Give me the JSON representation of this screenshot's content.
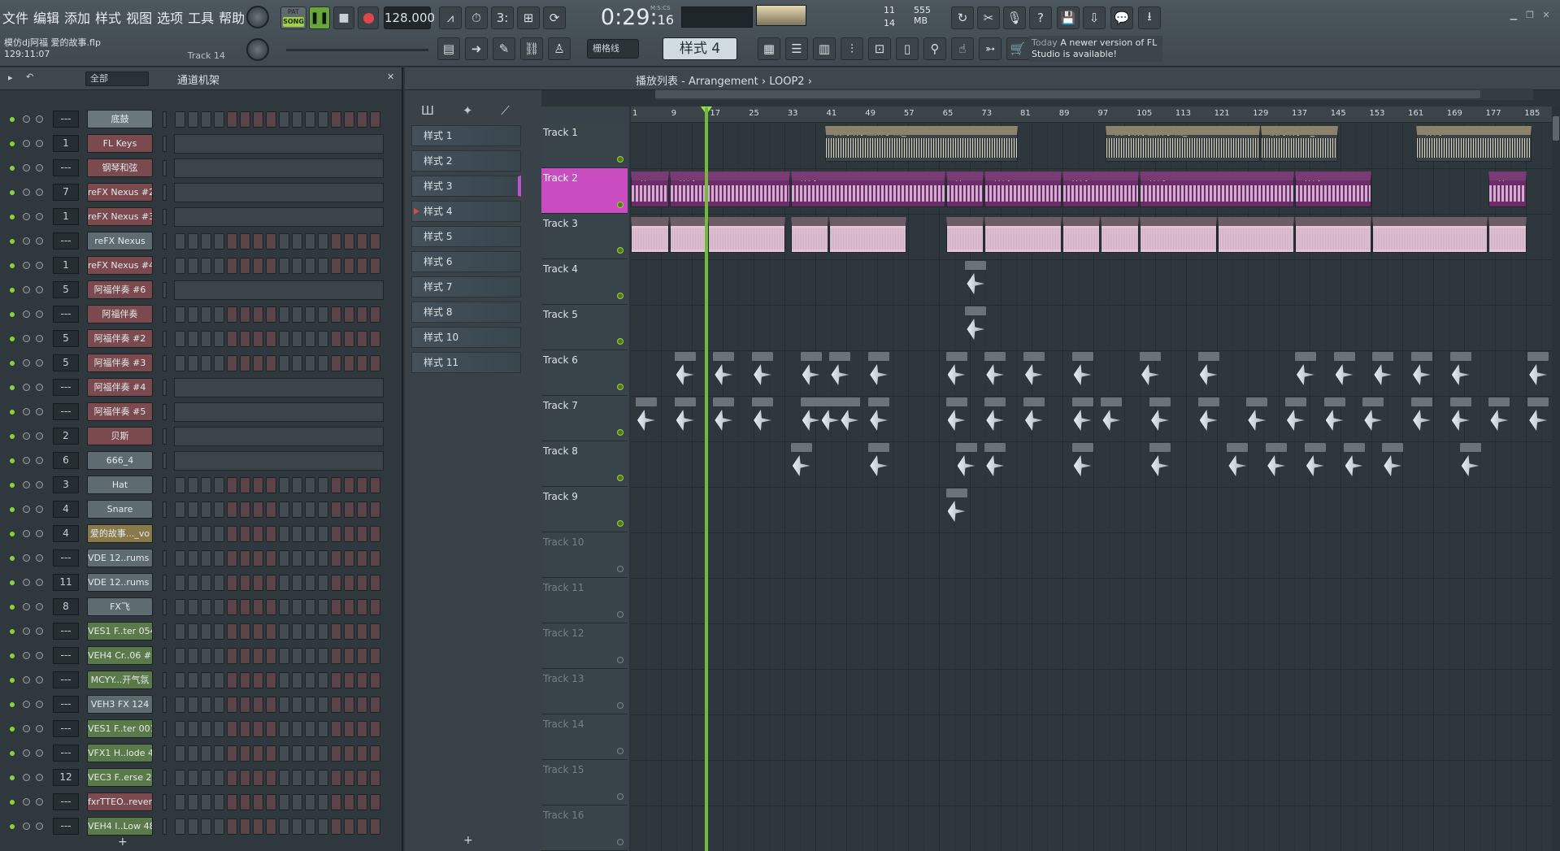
{
  "menu": [
    "文件",
    "编辑",
    "添加",
    "样式",
    "视图",
    "选项",
    "工具",
    "帮助"
  ],
  "project": {
    "title": "模仿dj阿福 爱的故事.flp",
    "time": "129:11:07",
    "track": "Track 14"
  },
  "transport": {
    "song_label": "SONG",
    "pat_label": "PAT",
    "tempo": "128.000",
    "time_main": "0:29",
    "time_sub": "16",
    "time_unit": "M:S:CS"
  },
  "cpu": {
    "voices": "11",
    "mem": "555 MB",
    "poly": "14"
  },
  "snap": "栅格线",
  "pattern": "样式 4",
  "news": {
    "today": "Today",
    "text": "A newer version of FL Studio is available!"
  },
  "rack": {
    "filter": "全部",
    "title": "通道机架",
    "add": "+"
  },
  "channels": [
    {
      "num": "---",
      "name": "底鼓",
      "color": "#6a787e",
      "type": "steps"
    },
    {
      "num": "1",
      "name": "FL Keys",
      "color": "#7a4a4f",
      "type": "roll"
    },
    {
      "num": "---",
      "name": "钢琴和弦",
      "color": "#7a4a4f",
      "type": "roll"
    },
    {
      "num": "7",
      "name": "reFX Nexus #2",
      "color": "#7a4a4f",
      "type": "roll"
    },
    {
      "num": "1",
      "name": "reFX Nexus #3",
      "color": "#7a4a4f",
      "type": "roll"
    },
    {
      "num": "---",
      "name": "reFX Nexus",
      "color": "#5e6c72",
      "type": "steps"
    },
    {
      "num": "1",
      "name": "reFX Nexus #4",
      "color": "#7a4a4f",
      "type": "steps"
    },
    {
      "num": "5",
      "name": "阿福伴奏 #6",
      "color": "#7a4a4f",
      "type": "roll"
    },
    {
      "num": "---",
      "name": "阿福伴奏",
      "color": "#7a4a4f",
      "type": "steps"
    },
    {
      "num": "5",
      "name": "阿福伴奏 #2",
      "color": "#7a4a4f",
      "type": "steps"
    },
    {
      "num": "5",
      "name": "阿福伴奏 #3",
      "color": "#7a4a4f",
      "type": "steps"
    },
    {
      "num": "---",
      "name": "阿福伴奏 #4",
      "color": "#7a4a4f",
      "type": "roll"
    },
    {
      "num": "---",
      "name": "阿福伴奏 #5",
      "color": "#7a4a4f",
      "type": "roll"
    },
    {
      "num": "2",
      "name": "贝斯",
      "color": "#7a4a4f",
      "type": "roll"
    },
    {
      "num": "6",
      "name": "666_4",
      "color": "#5e6c72",
      "type": "roll"
    },
    {
      "num": "3",
      "name": "Hat",
      "color": "#5e6c72",
      "type": "steps"
    },
    {
      "num": "4",
      "name": "Snare",
      "color": "#5e6c72",
      "type": "steps"
    },
    {
      "num": "4",
      "name": "爱的故事..._vo",
      "color": "#8a7a4a",
      "type": "steps"
    },
    {
      "num": "---",
      "name": "VDE 12..rums 1",
      "color": "#5e6c72",
      "type": "steps"
    },
    {
      "num": "11",
      "name": "VDE 12..rums 2",
      "color": "#5e6c72",
      "type": "steps"
    },
    {
      "num": "8",
      "name": "FX飞",
      "color": "#5e6c72",
      "type": "steps"
    },
    {
      "num": "---",
      "name": "VES1 F..ter 054",
      "color": "#5b7a4a",
      "type": "steps"
    },
    {
      "num": "---",
      "name": "VEH4 Cr..06 #2",
      "color": "#5b7a4a",
      "type": "steps"
    },
    {
      "num": "---",
      "name": "MCYY...开气氛",
      "color": "#5b7a4a",
      "type": "steps"
    },
    {
      "num": "---",
      "name": "VEH3 FX 124",
      "color": "#5e6c72",
      "type": "steps"
    },
    {
      "num": "---",
      "name": "VES1 F..ter 001",
      "color": "#5b7a4a",
      "type": "steps"
    },
    {
      "num": "---",
      "name": "VFX1 H..lode 44",
      "color": "#5b7a4a",
      "type": "steps"
    },
    {
      "num": "12",
      "name": "VEC3 F..erse 24",
      "color": "#5b7a4a",
      "type": "steps"
    },
    {
      "num": "---",
      "name": "fxrTTEO..reverse",
      "color": "#7a4a4f",
      "type": "steps"
    },
    {
      "num": "---",
      "name": "VEH4 I..Low 48",
      "color": "#5b7a4a",
      "type": "steps"
    }
  ],
  "patterns": [
    "样式 1",
    "样式 2",
    "样式 3",
    "样式 4",
    "样式 5",
    "样式 6",
    "样式 7",
    "样式 8",
    "样式 10",
    "样式 11"
  ],
  "playlist": {
    "crumb": "播放列表 - Arrangement › LOOP2 ›",
    "add": "+"
  },
  "tracks": [
    "Track 1",
    "Track 2",
    "Track 3",
    "Track 4",
    "Track 5",
    "Track 6",
    "Track 7",
    "Track 8",
    "Track 9",
    "Track 10",
    "Track 11",
    "Track 12",
    "Track 13",
    "Track 14",
    "Track 15",
    "Track 16"
  ],
  "bars": [
    "1",
    "9",
    "17",
    "25",
    "33",
    "41",
    "49",
    "57",
    "65",
    "73",
    "81",
    "89",
    "97",
    "105",
    "113",
    "121",
    "129",
    "137",
    "145",
    "153",
    "161",
    "169",
    "177",
    "185"
  ],
  "clips": {
    "audio": [
      {
        "label": "爱的故事上集-梦涵_vo",
        "start": 41,
        "len": 40
      },
      {
        "label": "爱的故事上集-梦涵_vo",
        "start": 99,
        "len": 32
      },
      {
        "label": "爱的故事..._vo",
        "start": 131,
        "len": 16
      },
      {
        "label": "样式 10",
        "start": 163,
        "len": 24
      }
    ],
    "pattern": [
      {
        "label": "样...2",
        "start": 1,
        "len": 8
      },
      {
        "label": "样式 3",
        "start": 9,
        "len": 25
      },
      {
        "label": "样式 6",
        "start": 34,
        "len": 32
      },
      {
        "label": "样...7",
        "start": 66,
        "len": 8
      },
      {
        "label": "样式 4",
        "start": 74,
        "len": 16
      },
      {
        "label": "样式 8",
        "start": 90,
        "len": 16
      },
      {
        "label": "样式 11",
        "start": 106,
        "len": 32
      },
      {
        "label": "样式 4",
        "start": 138,
        "len": 16
      },
      {
        "label": "样...2",
        "start": 178,
        "len": 8
      }
    ],
    "loop": [
      {
        "label": "LOOP1",
        "start": 1,
        "len": 8
      },
      {
        "label": "LOOP2",
        "start": 9,
        "len": 8
      },
      {
        "label": "LOOP2",
        "start": 17,
        "len": 16
      },
      {
        "label": "LOOP1",
        "start": 34,
        "len": 8
      },
      {
        "label": "LOOP2",
        "start": 42,
        "len": 16
      },
      {
        "label": "LOOP2",
        "start": 66,
        "len": 8
      },
      {
        "label": "LOOP2",
        "start": 74,
        "len": 16
      },
      {
        "label": "LOOP1",
        "start": 90,
        "len": 8
      },
      {
        "label": "LOOP2",
        "start": 98,
        "len": 8
      },
      {
        "label": "LOOP2",
        "start": 106,
        "len": 16
      },
      {
        "label": "LOOP2",
        "start": 122,
        "len": 16
      },
      {
        "label": "LOOP2",
        "start": 138,
        "len": 16
      },
      {
        "label": "LOOP2",
        "start": 154,
        "len": 24
      },
      {
        "label": "LOOP1",
        "start": 178,
        "len": 8
      }
    ]
  }
}
